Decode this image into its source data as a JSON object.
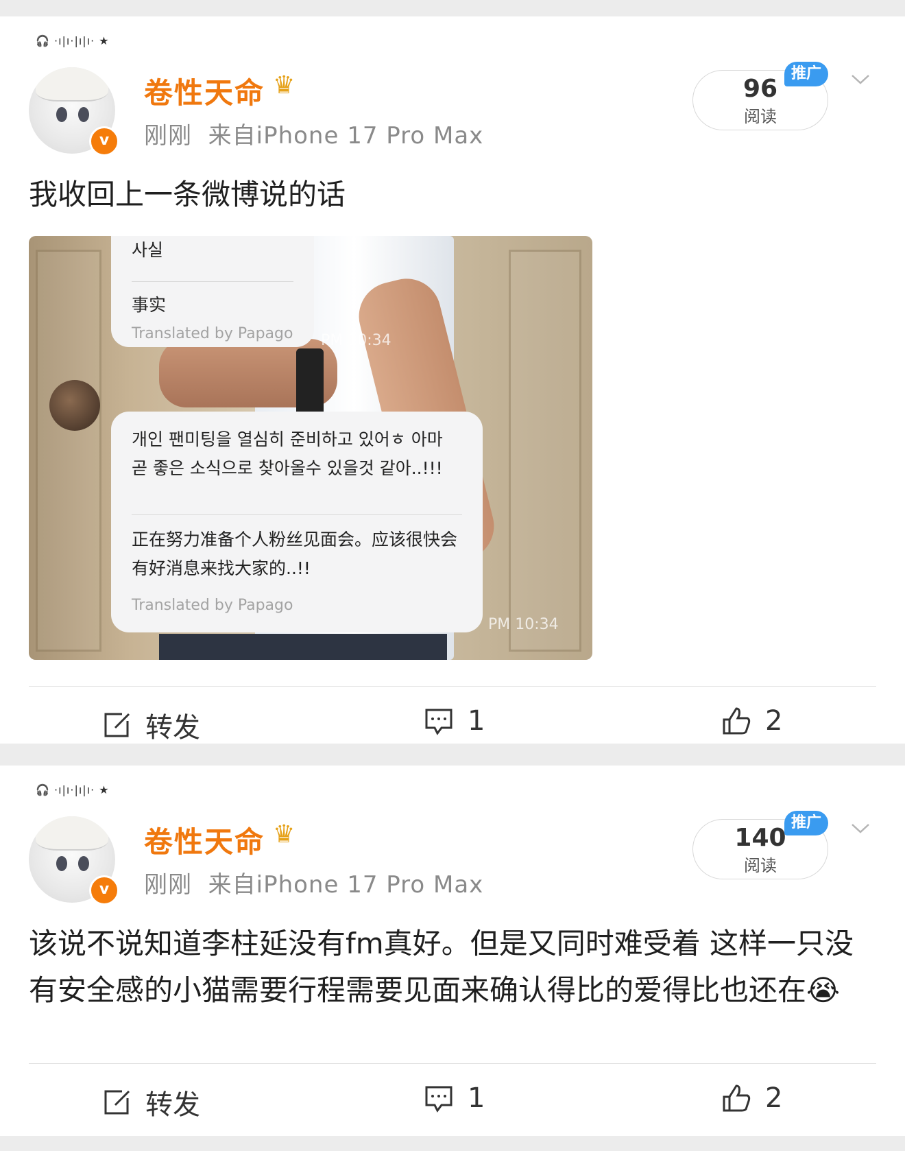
{
  "posts": [
    {
      "username": "卷性天命",
      "time": "刚刚",
      "source": "来自iPhone 17 Pro Max",
      "reads_count": "96",
      "reads_label": "阅读",
      "promo_tag": "推广",
      "text": "我收回上一条微博说的话",
      "image": {
        "bubble1_top": "사실",
        "bubble1_trans": "事实",
        "bubble1_papago": "Translated by Papago",
        "time1": "PM 10:34",
        "bubble2_korean": "개인 팬미팅을 열심히 준비하고 있어ㅎ 아마 곧 좋은 소식으로 찾아올수 있을것 같아..!!!",
        "bubble2_chinese": "正在努力准备个人粉丝见面会。应该很快会有好消息来找大家的..!!",
        "bubble2_papago": "Translated by Papago",
        "time2": "PM 10:34"
      },
      "repost_label": "转发",
      "comments": "1",
      "likes": "2"
    },
    {
      "username": "卷性天命",
      "time": "刚刚",
      "source": "来自iPhone 17 Pro Max",
      "reads_count": "140",
      "reads_label": "阅读",
      "promo_tag": "推广",
      "text": "该说不说知道李柱延没有fm真好。但是又同时难受着 这样一只没有安全感的小猫需要行程需要见面来确认得比的爱得比也还在😭",
      "repost_label": "转发",
      "comments": "1",
      "likes": "2"
    }
  ],
  "colors": {
    "username": "#f0780e",
    "verified": "#f57c0a",
    "promo": "#3a9bf0"
  },
  "icons": [
    "headphone-icon",
    "crown-icon",
    "verified-icon",
    "chevron-down-icon",
    "repost-icon",
    "comment-icon",
    "like-icon"
  ]
}
